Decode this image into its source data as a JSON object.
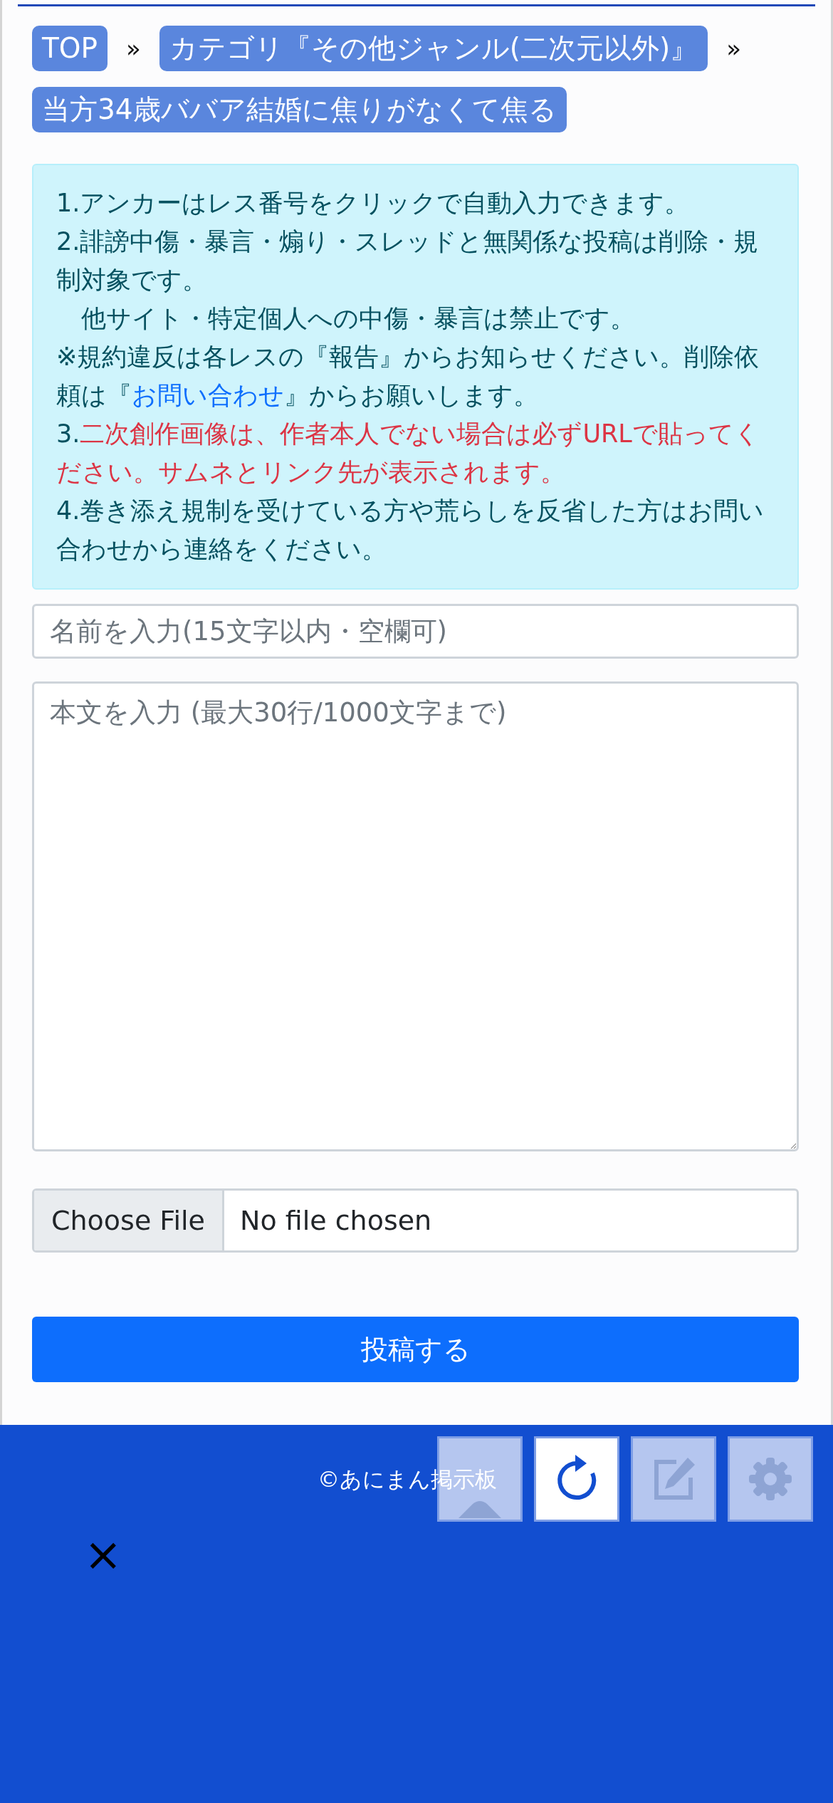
{
  "breadcrumbs": [
    {
      "label": "TOP"
    },
    {
      "label": "カテゴリ『その他ジャンル(二次元以外)』"
    },
    {
      "label": "当方34歳ババア結婚に焦りがなくて焦る"
    }
  ],
  "breadcrumb_separator": "»",
  "notice": [
    {
      "parts": [
        {
          "kind": "plain",
          "text": "1.アンカーはレス番号をクリックで自動入力できます。"
        }
      ]
    },
    {
      "parts": [
        {
          "kind": "plain",
          "text": "2.誹謗中傷・暴言・煽り・スレッドと無関係な投稿は削除・規制対象です。"
        }
      ]
    },
    {
      "parts": [
        {
          "kind": "plain",
          "text": "　他サイト・特定個人への中傷・暴言は禁止です。"
        }
      ]
    },
    {
      "parts": [
        {
          "kind": "plain",
          "text": "※規約違反は各レスの『報告』からお知らせください。削除依頼は『"
        },
        {
          "kind": "link",
          "text": "お問い合わせ"
        },
        {
          "kind": "plain",
          "text": "』からお願いします。"
        }
      ]
    },
    {
      "parts": [
        {
          "kind": "plain",
          "text": "3."
        },
        {
          "kind": "danger",
          "text": "二次創作画像は、作者本人でない場合は必ずURLで貼ってください。サムネとリンク先が表示されます。"
        }
      ]
    },
    {
      "parts": [
        {
          "kind": "plain",
          "text": "4.巻き添え規制を受けている方や荒らしを反省した方はお問い合わせから連絡をください。"
        }
      ]
    }
  ],
  "name_field": {
    "placeholder": "名前を入力(15文字以内・空欄可)"
  },
  "body_field": {
    "placeholder": "本文を入力 (最大30行/1000文字まで)"
  },
  "file_input": {
    "button": "Choose File",
    "status": "No file chosen"
  },
  "submit_button": "投稿する",
  "footer": {
    "copyright": "©あにまん掲示板"
  },
  "floating_buttons": [
    {
      "kind": "up",
      "disabled": true
    },
    {
      "kind": "reload",
      "disabled": false
    },
    {
      "kind": "edit",
      "disabled": true
    },
    {
      "kind": "settings",
      "disabled": true
    }
  ],
  "close_button": "×"
}
